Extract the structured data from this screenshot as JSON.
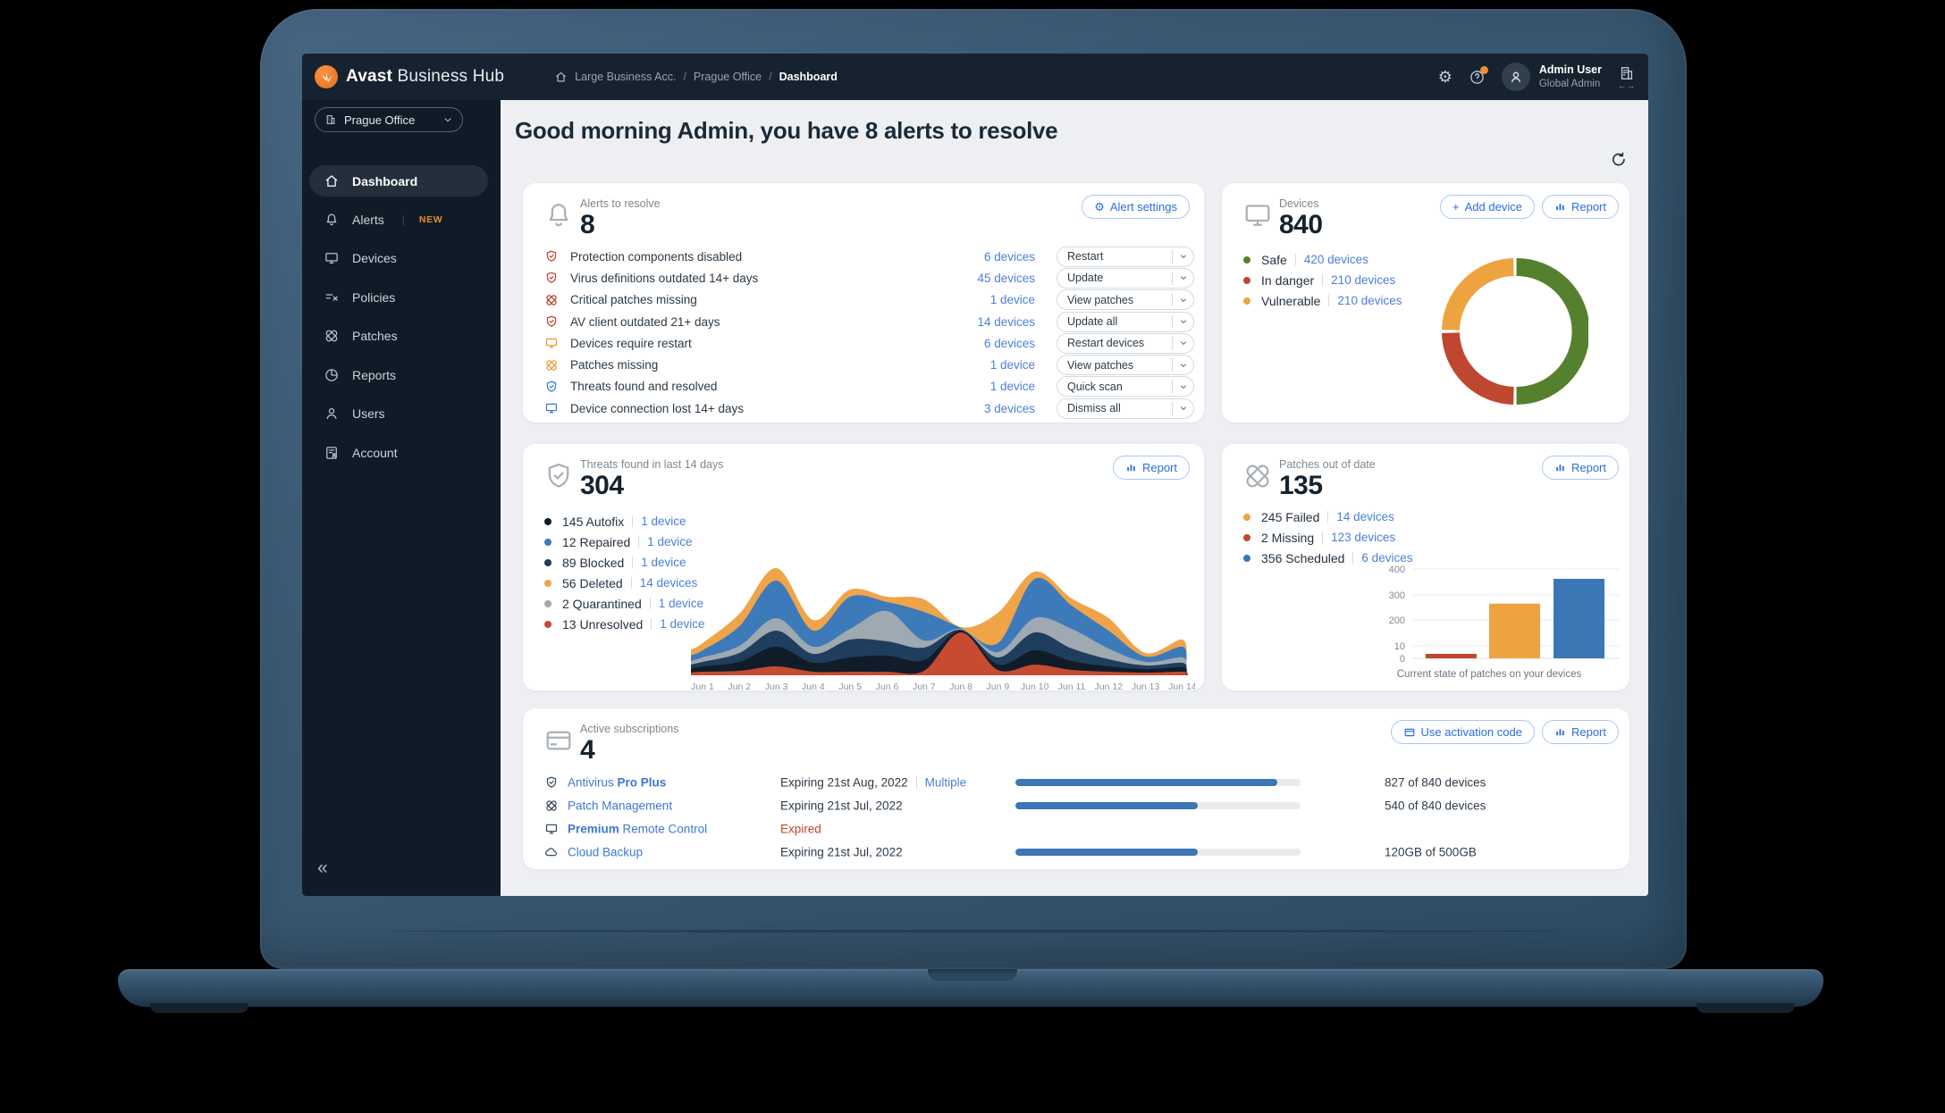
{
  "app": {
    "brand": {
      "bold": "Avast",
      "light": "Business Hub"
    },
    "breadcrumb": [
      "Large Business Acc.",
      "Prague Office",
      "Dashboard"
    ],
    "user": {
      "name": "Admin User",
      "role": "Global Admin"
    },
    "org_selector": "Prague Office",
    "sidebar": {
      "items": [
        {
          "label": "Dashboard",
          "icon": "home",
          "active": true
        },
        {
          "label": "Alerts",
          "icon": "bell",
          "badge": "NEW"
        },
        {
          "label": "Devices",
          "icon": "monitor"
        },
        {
          "label": "Policies",
          "icon": "policies"
        },
        {
          "label": "Patches",
          "icon": "patches"
        },
        {
          "label": "Reports",
          "icon": "reports"
        },
        {
          "label": "Users",
          "icon": "user"
        },
        {
          "label": "Account",
          "icon": "account"
        }
      ],
      "collapse_glyph": "«"
    },
    "heading": "Good morning Admin, you have 8 alerts to resolve"
  },
  "cards": {
    "alerts": {
      "label": "Alerts to resolve",
      "value": "8",
      "settings_button": "Alert settings",
      "rows": [
        {
          "icon": "shield-check",
          "tone": "red",
          "label": "Protection components disabled",
          "link": "6 devices",
          "action": "Restart"
        },
        {
          "icon": "shield-check",
          "tone": "red",
          "label": "Virus definitions outdated 14+ days",
          "link": "45 devices",
          "action": "Update"
        },
        {
          "icon": "patches",
          "tone": "red",
          "label": "Critical patches missing",
          "link": "1 device",
          "action": "View patches"
        },
        {
          "icon": "shield-check",
          "tone": "red",
          "label": "AV client outdated 21+ days",
          "link": "14 devices",
          "action": "Update all"
        },
        {
          "icon": "monitor",
          "tone": "orange",
          "label": "Devices require restart",
          "link": "6 devices",
          "action": "Restart devices"
        },
        {
          "icon": "patches",
          "tone": "orange",
          "label": "Patches missing",
          "link": "1 device",
          "action": "View patches"
        },
        {
          "icon": "shield-check",
          "tone": "blue",
          "label": "Threats found and resolved",
          "link": "1 device",
          "action": "Quick scan"
        },
        {
          "icon": "monitor",
          "tone": "blue",
          "label": "Device connection lost 14+ days",
          "link": "3 devices",
          "action": "Dismiss all"
        }
      ]
    },
    "devices": {
      "label": "Devices",
      "value": "840",
      "add_button": "Add device",
      "report_button": "Report",
      "legend": [
        {
          "label": "Safe",
          "link": "420 devices",
          "color": "#55802d"
        },
        {
          "label": "In danger",
          "link": "210 devices",
          "color": "#bf4730"
        },
        {
          "label": "Vulnerable",
          "link": "210 devices",
          "color": "#eea341"
        }
      ]
    },
    "threats": {
      "label": "Threats found in last 14 days",
      "value": "304",
      "report_button": "Report",
      "legend": [
        {
          "count": "145",
          "label": "Autofix",
          "link": "1 device",
          "color": "#101d29"
        },
        {
          "count": "12",
          "label": "Repaired",
          "link": "1 device",
          "color": "#3d7ab9"
        },
        {
          "count": "89",
          "label": "Blocked",
          "link": "1 device",
          "color": "#1f3d5c"
        },
        {
          "count": "56",
          "label": "Deleted",
          "link": "14 devices",
          "color": "#f0a44a"
        },
        {
          "count": "2",
          "label": "Quarantined",
          "link": "1 device",
          "color": "#9fa9b1"
        },
        {
          "count": "13",
          "label": "Unresolved",
          "link": "1 device",
          "color": "#c64b30"
        }
      ]
    },
    "patches": {
      "label": "Patches out of date",
      "value": "135",
      "report_button": "Report",
      "legend": [
        {
          "count": "245",
          "label": "Failed",
          "link": "14 devices",
          "color": "#eea341"
        },
        {
          "count": "2",
          "label": "Missing",
          "link": "123 devices",
          "color": "#bf4730"
        },
        {
          "count": "356",
          "label": "Scheduled",
          "link": "6 devices",
          "color": "#3b76b5"
        }
      ],
      "caption": "Current state of patches on your devices"
    },
    "subscriptions": {
      "label": "Active subscriptions",
      "value": "4",
      "activation_button": "Use activation code",
      "report_button": "Report",
      "rows": [
        {
          "icon": "shield-check",
          "name_regular": "Antivirus ",
          "name_bold": "Pro Plus",
          "bold_first": false,
          "expiry": "Expiring 21st Aug, 2022",
          "extra": "Multiple",
          "progress": 0.92,
          "usage": "827 of 840 devices"
        },
        {
          "icon": "patches",
          "name_regular": "Patch Management",
          "expiry": "Expiring 21st Jul, 2022",
          "progress": 0.64,
          "usage": "540 of 840 devices"
        },
        {
          "icon": "monitor",
          "name_bold": "Premium",
          "name_regular": " Remote Control",
          "bold_first": true,
          "expired": "Expired"
        },
        {
          "icon": "cloud",
          "name_regular": "Cloud Backup",
          "expiry": "Expiring 21st Jul, 2022",
          "progress": 0.64,
          "usage": "120GB of 500GB"
        }
      ]
    }
  },
  "chart_data": [
    {
      "id": "devices-donut",
      "type": "pie",
      "subtype": "donut",
      "segments": [
        {
          "label": "Safe",
          "value": 420,
          "color": "#55802d"
        },
        {
          "label": "In danger",
          "value": 210,
          "color": "#bf4730"
        },
        {
          "label": "Vulnerable",
          "value": 210,
          "color": "#eea341"
        }
      ],
      "start": "top",
      "direction": "clockwise",
      "total": 840
    },
    {
      "id": "threats-area",
      "type": "area",
      "subtype": "stacked",
      "x": [
        "Jun 1",
        "Jun 2",
        "Jun 3",
        "Jun 4",
        "Jun 5",
        "Jun 6",
        "Jun 7",
        "Jun 8",
        "Jun 9",
        "Jun 10",
        "Jun 11",
        "Jun 12",
        "Jun 13",
        "Jun 14"
      ],
      "series": [
        {
          "name": "Unresolved",
          "color": "#c64b30",
          "values": [
            4,
            5,
            10,
            4,
            4,
            4,
            5,
            48,
            6,
            12,
            6,
            4,
            3,
            4
          ]
        },
        {
          "name": "Autofix",
          "color": "#101d29",
          "values": [
            6,
            10,
            22,
            10,
            16,
            18,
            12,
            2,
            6,
            16,
            10,
            6,
            4,
            5
          ]
        },
        {
          "name": "Blocked",
          "color": "#1f3d5c",
          "values": [
            5,
            10,
            18,
            10,
            20,
            16,
            14,
            1,
            8,
            20,
            14,
            8,
            4,
            5
          ]
        },
        {
          "name": "Quarantined",
          "color": "#9fa9b1",
          "values": [
            5,
            8,
            14,
            8,
            12,
            34,
            8,
            1,
            6,
            16,
            22,
            12,
            4,
            6
          ]
        },
        {
          "name": "Repaired",
          "color": "#3d7ab9",
          "values": [
            8,
            22,
            42,
            18,
            36,
            10,
            32,
            1,
            10,
            44,
            26,
            20,
            6,
            12
          ]
        },
        {
          "name": "Deleted",
          "color": "#f0a44a",
          "values": [
            8,
            14,
            14,
            12,
            8,
            6,
            14,
            1,
            34,
            8,
            8,
            14,
            4,
            8
          ]
        }
      ],
      "legend_position": "left",
      "grid": false
    },
    {
      "id": "patches-bar",
      "type": "bar",
      "yticks": [
        "400",
        "300",
        "200",
        "10",
        "0"
      ],
      "ylim": [
        0,
        400
      ],
      "bars": [
        {
          "label": "Missing",
          "value": 2,
          "color": "#bf4730"
        },
        {
          "label": "Failed",
          "value": 245,
          "color": "#eea341"
        },
        {
          "label": "Scheduled",
          "value": 356,
          "color": "#3b76b5"
        }
      ],
      "title": "Current state of patches on your devices",
      "grid": true
    }
  ]
}
